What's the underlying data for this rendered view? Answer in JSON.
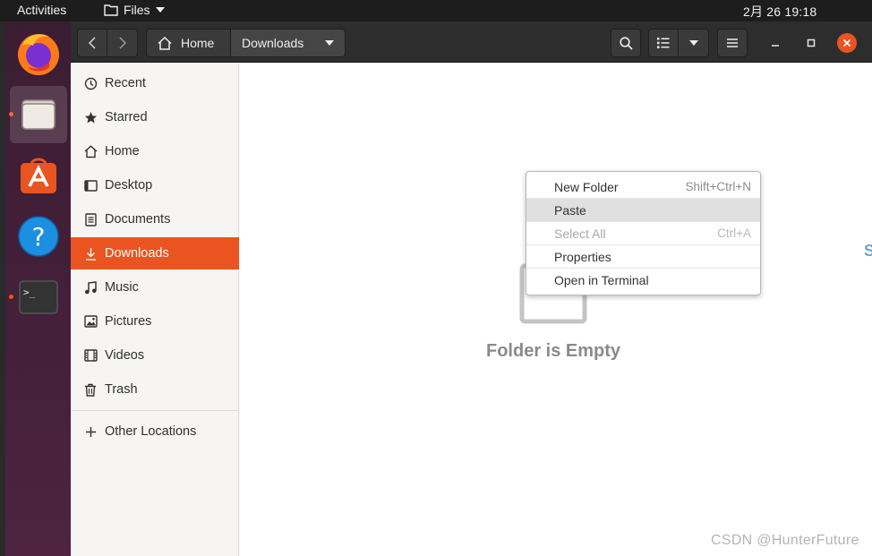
{
  "topbar": {
    "activities": "Activities",
    "app_menu": "Files",
    "clock": "2月 26  19:18"
  },
  "dock": {
    "apps": [
      {
        "name": "Firefox",
        "icon": "firefox-icon",
        "running": false
      },
      {
        "name": "Files",
        "icon": "files-icon",
        "running": true,
        "active": true
      },
      {
        "name": "Ubuntu Software",
        "icon": "software-icon",
        "running": false
      },
      {
        "name": "Help",
        "icon": "help-icon",
        "running": false
      },
      {
        "name": "Terminal",
        "icon": "terminal-icon",
        "running": true
      }
    ]
  },
  "headerbar": {
    "path": [
      "Home",
      "Downloads"
    ]
  },
  "sidebar": {
    "items": [
      {
        "label": "Recent",
        "icon": "clock-icon"
      },
      {
        "label": "Starred",
        "icon": "star-icon"
      },
      {
        "label": "Home",
        "icon": "home-icon"
      },
      {
        "label": "Desktop",
        "icon": "desktop-icon"
      },
      {
        "label": "Documents",
        "icon": "document-icon"
      },
      {
        "label": "Downloads",
        "icon": "download-icon",
        "selected": true
      },
      {
        "label": "Music",
        "icon": "music-icon"
      },
      {
        "label": "Pictures",
        "icon": "picture-icon"
      },
      {
        "label": "Videos",
        "icon": "video-icon"
      },
      {
        "label": "Trash",
        "icon": "trash-icon"
      }
    ],
    "other_locations": "Other Locations"
  },
  "content": {
    "empty_message": "Folder is Empty",
    "edge_glyph": "S"
  },
  "context_menu": {
    "items": [
      {
        "label": "New Folder",
        "accel": "Shift+Ctrl+N",
        "state": "normal"
      },
      {
        "label": "Paste",
        "accel": "",
        "state": "hover"
      },
      {
        "label": "Select All",
        "accel": "Ctrl+A",
        "state": "disabled"
      },
      {
        "label": "Properties",
        "accel": "",
        "state": "normal"
      },
      {
        "label": "Open in Terminal",
        "accel": "",
        "state": "normal"
      }
    ]
  },
  "watermark": "CSDN @HunterFuture",
  "colors": {
    "accent": "#e95420",
    "headerbar": "#2d2d2d",
    "topbar": "#1d1d1d"
  }
}
